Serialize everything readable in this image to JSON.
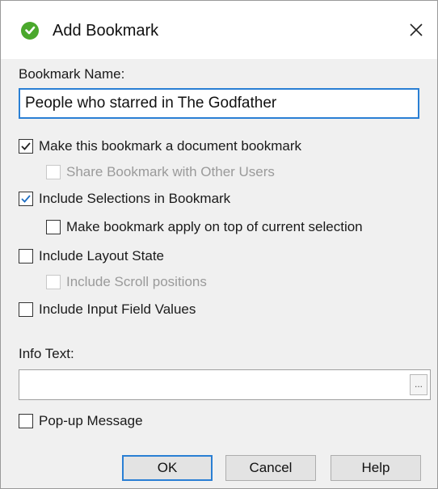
{
  "window": {
    "title": "Add Bookmark",
    "close_glyph": "✕"
  },
  "form": {
    "name_label": "Bookmark Name:",
    "name_value": "People who starred in The Godfather",
    "options": {
      "document_bookmark": {
        "label": "Make this bookmark a document bookmark",
        "checked": true,
        "enabled": true
      },
      "share_with_users": {
        "label": "Share Bookmark with Other Users",
        "checked": false,
        "enabled": false
      },
      "include_selections": {
        "label": "Include Selections in Bookmark",
        "checked": true,
        "enabled": true
      },
      "apply_on_top": {
        "label": "Make bookmark apply on top of current selection",
        "checked": false,
        "enabled": true
      },
      "include_layout": {
        "label": "Include Layout State",
        "checked": false,
        "enabled": true
      },
      "include_scroll": {
        "label": "Include Scroll positions",
        "checked": false,
        "enabled": false
      },
      "include_input_fields": {
        "label": "Include Input Field Values",
        "checked": false,
        "enabled": true
      }
    },
    "info_label": "Info Text:",
    "info_value": "",
    "browse_label": "...",
    "popup": {
      "label": "Pop-up Message",
      "checked": false,
      "enabled": true
    }
  },
  "buttons": {
    "ok": "OK",
    "cancel": "Cancel",
    "help": "Help"
  },
  "colors": {
    "accent": "#2a7fd4",
    "check_blue": "#1f6fc4",
    "check_dark": "#222222",
    "app_green": "#4aa82c"
  },
  "icons": {
    "app": "qlikview-logo-icon",
    "close": "close-icon",
    "check": "checkmark-icon"
  }
}
